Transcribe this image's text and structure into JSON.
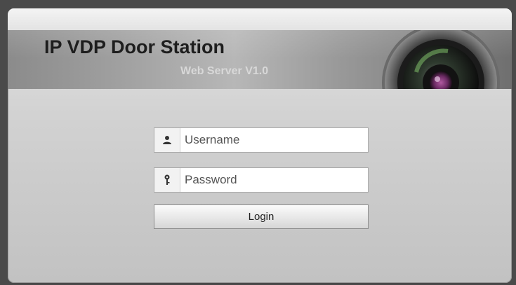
{
  "header": {
    "title": "IP VDP Door Station",
    "subtitle": "Web Server V1.0"
  },
  "login": {
    "username_placeholder": "Username",
    "password_placeholder": "Password",
    "login_label": "Login"
  },
  "icons": {
    "username": "user-icon",
    "password": "key-icon",
    "banner": "camera-lens-icon"
  },
  "colors": {
    "lens_accent": "#8a2f7a"
  }
}
